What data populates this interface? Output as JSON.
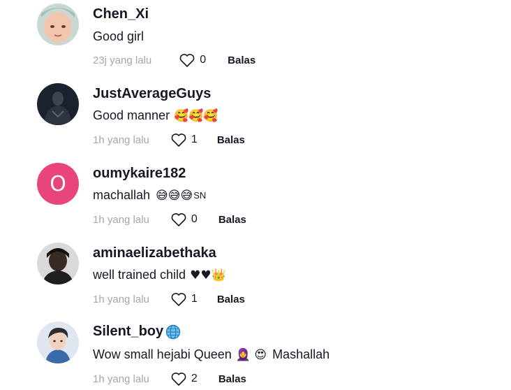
{
  "comments": [
    {
      "username": "Chen_Xi",
      "text": "Good girl",
      "time": "23j yang lalu",
      "likes": "0",
      "reply": "Balas"
    },
    {
      "username": "JustAverageGuys",
      "text": "Good manner",
      "emoji": "🥰🥰🥰",
      "time": "1h yang lalu",
      "likes": "1",
      "reply": "Balas"
    },
    {
      "username": "oumykaire182",
      "avatar_letter": "O",
      "text": "machallah",
      "emoji": "😅😅😅",
      "suffix": "SN",
      "time": "1h yang lalu",
      "likes": "0",
      "reply": "Balas"
    },
    {
      "username": "aminaelizabethaka",
      "text": "well trained child",
      "emoji": "♥♥👑",
      "time": "1h yang lalu",
      "likes": "1",
      "reply": "Balas"
    },
    {
      "username": "Silent_boy",
      "username_emoji": "🌐",
      "text": "Wow small hejabi Queen",
      "emoji": "🧕 😍",
      "suffix": "Mashallah",
      "time": "1h yang lalu",
      "likes": "2",
      "reply": "Balas"
    }
  ],
  "colors": {
    "text": "#161823",
    "muted": "#a5a6aa",
    "avatar_pink": "#e8457c"
  }
}
